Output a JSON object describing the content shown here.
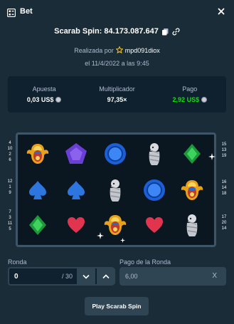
{
  "header": {
    "title": "Bet",
    "icon": "bet-slip-icon",
    "close_icon": "close-icon"
  },
  "bet": {
    "id_text": "Scarab Spin: 84.173.087.647",
    "placed_by_label": "Realizada por",
    "user": "mpd091diox",
    "date_text": "el 11/4/2022 a las 9:45"
  },
  "stats": {
    "wager_label": "Apuesta",
    "wager_value": "0,03 US$",
    "multiplier_label": "Multiplicador",
    "multiplier_value": "97,35×",
    "payout_label": "Pago",
    "payout_value": "2,92 US$"
  },
  "board": {
    "left_numbers": [
      [
        "4",
        "10",
        "2",
        "6"
      ],
      [
        "12",
        "1",
        "9"
      ],
      [
        "7",
        "3",
        "11",
        "5"
      ]
    ],
    "right_numbers": [
      [
        "15",
        "13",
        "19"
      ],
      [
        "16",
        "14",
        "18"
      ],
      [
        "17",
        "20",
        "14"
      ]
    ],
    "grid": [
      [
        "scarab",
        "pentagon",
        "circle",
        "mummy",
        "diamond"
      ],
      [
        "spade",
        "spade",
        "mummy",
        "circle",
        "scarab"
      ],
      [
        "diamond",
        "heart",
        "scarab",
        "heart",
        "mummy"
      ]
    ]
  },
  "form": {
    "round_label": "Ronda",
    "round_value": "0",
    "round_total": "/ 30",
    "round_payout_label": "Pago de la Ronda",
    "round_payout_value": "6,00",
    "round_payout_suffix": "X"
  },
  "actions": {
    "play_label": "Play Scarab Spin"
  },
  "colors": {
    "background": "#1a2c38",
    "panel": "#0f212e",
    "button": "#2f4553",
    "muted_text": "#b1bad3",
    "win_text": "#00e701"
  }
}
